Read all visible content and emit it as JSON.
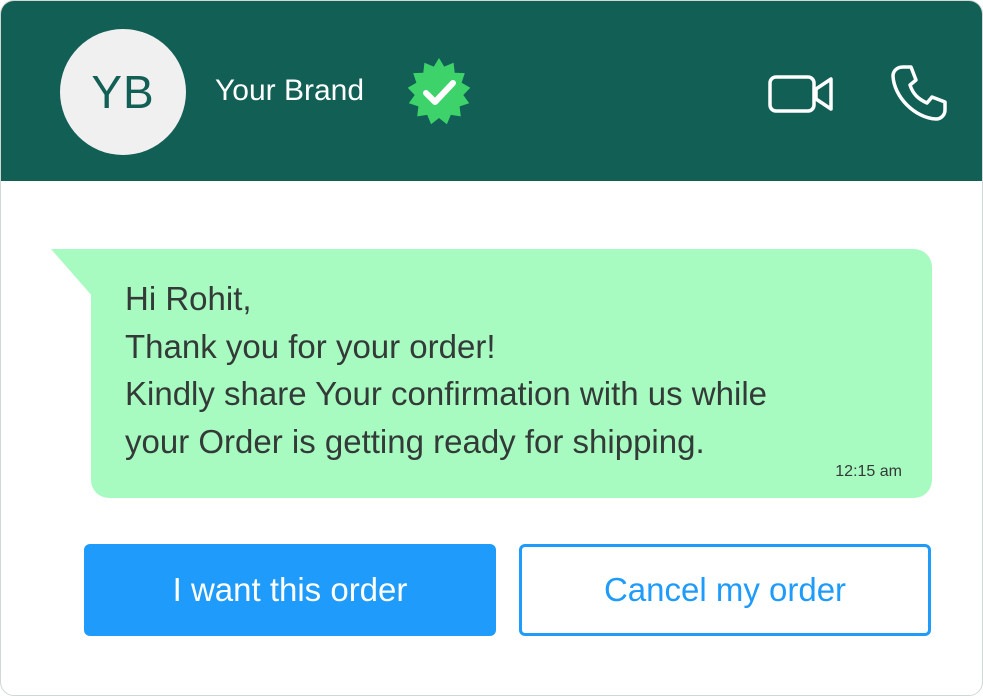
{
  "header": {
    "avatar_initials": "YB",
    "brand_name": "Your Brand",
    "verified_icon": "verified-badge-icon",
    "video_icon": "video-camera-icon",
    "call_icon": "phone-icon",
    "background_color": "#115f55"
  },
  "message": {
    "lines": [
      "Hi Rohit,",
      "Thank you for your order!",
      "Kindly share Your confirmation with us while",
      "your Order is getting ready for shipping."
    ],
    "time": "12:15 am",
    "bubble_color": "#a7fbc1"
  },
  "actions": {
    "accept_label": "I want this order",
    "cancel_label": "Cancel my order",
    "accent_color": "#1e9bfb"
  }
}
